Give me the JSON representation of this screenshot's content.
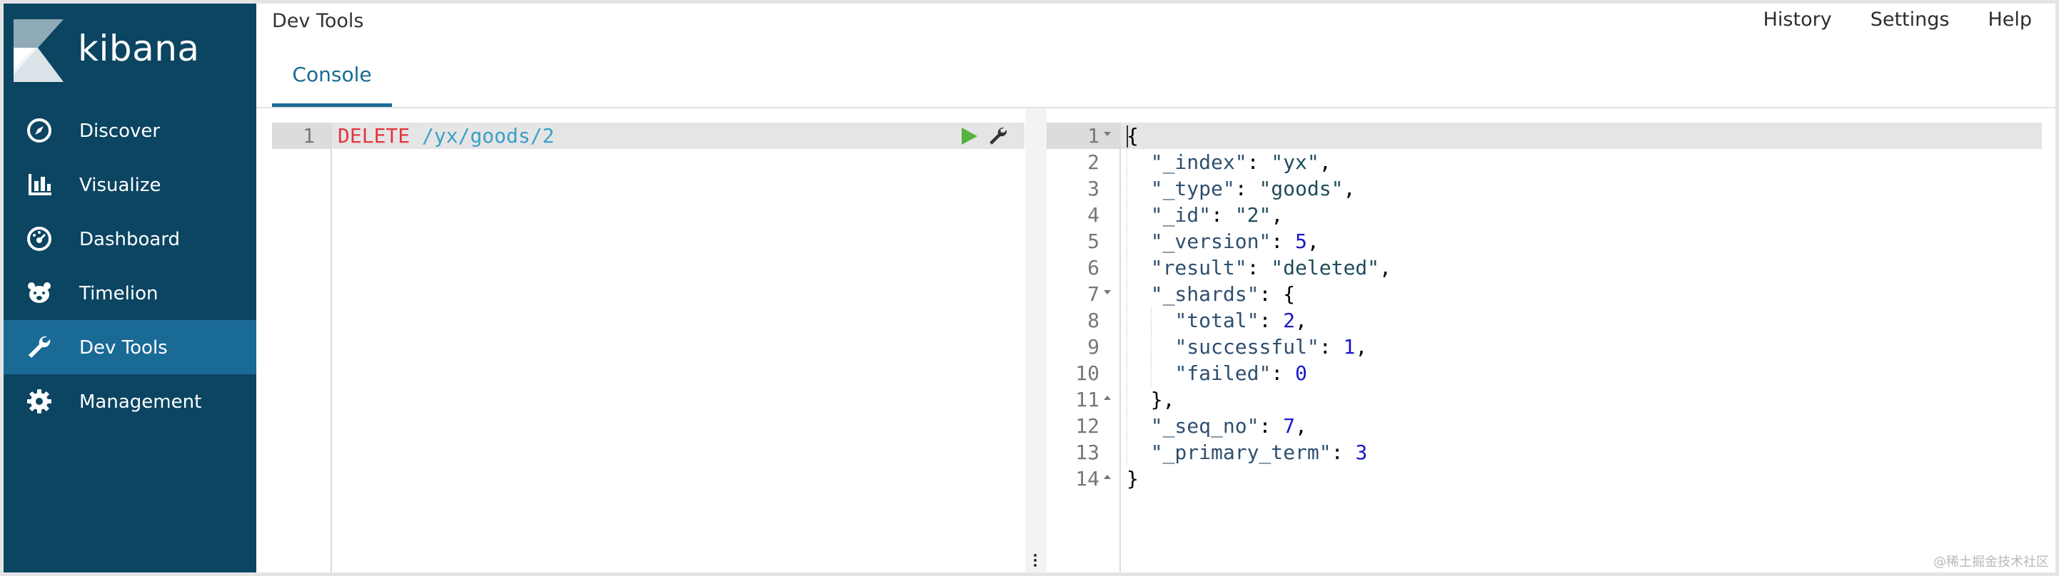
{
  "brand": {
    "name": "kibana"
  },
  "sidebar": {
    "items": [
      {
        "label": "Discover",
        "icon": "compass-icon",
        "active": false
      },
      {
        "label": "Visualize",
        "icon": "bar-chart-icon",
        "active": false
      },
      {
        "label": "Dashboard",
        "icon": "dashboard-gauge-icon",
        "active": false
      },
      {
        "label": "Timelion",
        "icon": "timelion-bear-icon",
        "active": false
      },
      {
        "label": "Dev Tools",
        "icon": "wrench-icon",
        "active": true
      },
      {
        "label": "Management",
        "icon": "gear-icon",
        "active": false
      }
    ]
  },
  "header": {
    "title": "Dev Tools",
    "links": {
      "history": "History",
      "settings": "Settings",
      "help": "Help"
    },
    "tabs": [
      {
        "label": "Console",
        "active": true
      }
    ]
  },
  "editor": {
    "line_number": "1",
    "method": "DELETE",
    "url": " /yx/goods/2"
  },
  "output": {
    "lines": [
      {
        "n": "1",
        "fold": "down",
        "text": "{"
      },
      {
        "n": "2",
        "fold": "",
        "text": "  \"_index\": \"yx\","
      },
      {
        "n": "3",
        "fold": "",
        "text": "  \"_type\": \"goods\","
      },
      {
        "n": "4",
        "fold": "",
        "text": "  \"_id\": \"2\","
      },
      {
        "n": "5",
        "fold": "",
        "text": "  \"_version\": 5,"
      },
      {
        "n": "6",
        "fold": "",
        "text": "  \"result\": \"deleted\","
      },
      {
        "n": "7",
        "fold": "down",
        "text": "  \"_shards\": {"
      },
      {
        "n": "8",
        "fold": "",
        "text": "    \"total\": 2,"
      },
      {
        "n": "9",
        "fold": "",
        "text": "    \"successful\": 1,"
      },
      {
        "n": "10",
        "fold": "",
        "text": "    \"failed\": 0"
      },
      {
        "n": "11",
        "fold": "up",
        "text": "  },"
      },
      {
        "n": "12",
        "fold": "",
        "text": "  \"_seq_no\": 7,"
      },
      {
        "n": "13",
        "fold": "",
        "text": "  \"_primary_term\": 3"
      },
      {
        "n": "14",
        "fold": "up",
        "text": "}"
      }
    ]
  },
  "watermark": "@稀土掘金技术社区",
  "colors": {
    "sidebar_bg": "#0b4562",
    "sidebar_active": "#1a6a96",
    "accent": "#1a6a96",
    "method": "#e2363e",
    "url": "#3aa0c8",
    "json_number": "#1a17c8",
    "run_green": "#54b33e"
  }
}
